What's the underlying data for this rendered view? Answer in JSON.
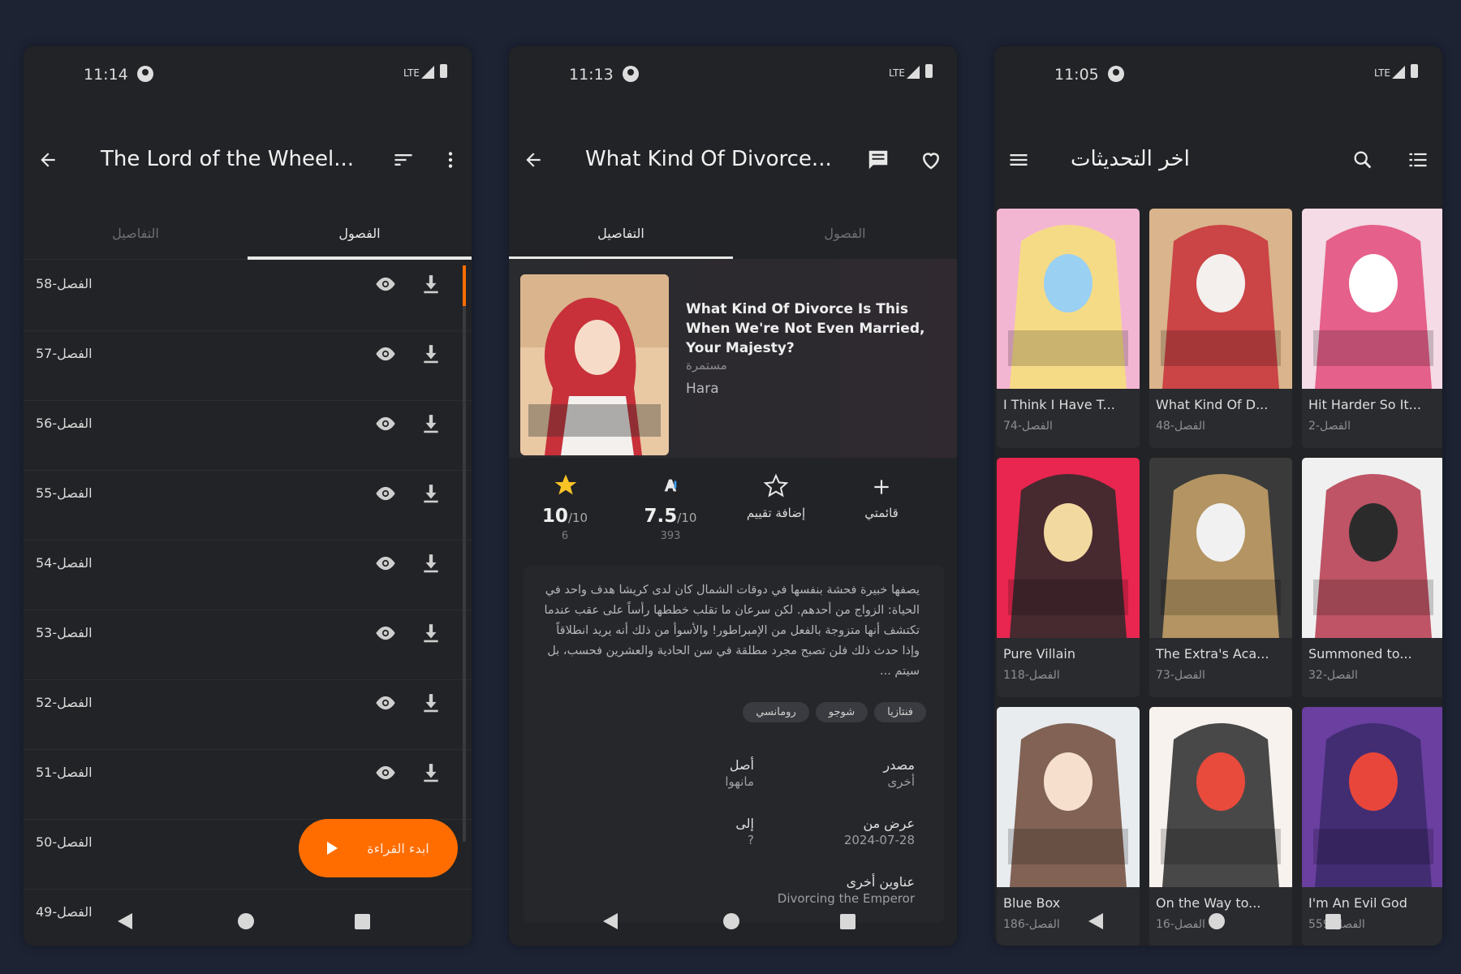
{
  "accent": "#ff6d00",
  "phone1": {
    "status": {
      "time": "11:14",
      "network": "LTE"
    },
    "title": "The Lord of the Wheel...",
    "tabs": [
      "التفاصيل",
      "الفصول"
    ],
    "chapters": [
      "الفصل-58",
      "الفصل-57",
      "الفصل-56",
      "الفصل-55",
      "الفصل-54",
      "الفصل-53",
      "الفصل-52",
      "الفصل-51",
      "الفصل-50",
      "الفصل-49"
    ],
    "fab_label": "ابدء القراءة",
    "icons": {
      "back": "arrow-back-icon",
      "sort": "sort-icon",
      "menu": "more-vert-icon",
      "eye": "eye-icon",
      "download": "download-icon",
      "play": "play-icon"
    }
  },
  "phone2": {
    "status": {
      "time": "11:13",
      "network": "LTE"
    },
    "title": "What Kind Of Divorce...",
    "tabs": [
      "التفاصيل",
      "الفصول"
    ],
    "manga_title": "What Kind Of Divorce Is This When We're Not Even Married, Your Majesty?",
    "status_text": "مستمرة",
    "author": "Hara",
    "stats": {
      "rating": {
        "value": "10",
        "suffix": "/10",
        "count": "6"
      },
      "anilist": {
        "value": "7.5",
        "suffix": "/10",
        "count": "393"
      },
      "rate": {
        "label": "إضافة تقييم"
      },
      "list": {
        "label": "قائمتي"
      }
    },
    "description": "يصفها خبيرة فحشة بنفسها في دوقات الشمال كان لدى كريشا هدف واحد في الحياة: الزواج من أحدهم. لكن سرعان ما تقلب خططها رأساً على عقب عندما تكتشف أنها متزوجة بالفعل من الإمبراطور! والأسوأ من ذلك أنه يريد انطلاقاً وإذا حدث ذلك فلن تصبح مجرد مطلقة في سن الحادية والعشرين فحسب، بل سيتم ...",
    "genres": [
      "فنتازيا",
      "شوجو",
      "رومانسي"
    ],
    "info": {
      "source_k": "مصدر",
      "source_v": "أخرى",
      "origin_k": "أصل",
      "origin_v": "مانهوا",
      "from_k": "عرض من",
      "from_v": "2024-07-28",
      "to_k": "إلى",
      "to_v": "?",
      "alt_k": "عناوين أخرى",
      "alt_v": "Divorcing the Emperor"
    },
    "icons": {
      "back": "arrow-back-icon",
      "comment": "comment-icon",
      "favorite": "heart-icon",
      "star": "star-filled-icon",
      "anilist": "anilist-icon",
      "rate": "star-outline-icon",
      "add": "plus-icon"
    }
  },
  "phone3": {
    "status": {
      "time": "11:05",
      "network": "LTE"
    },
    "title": "اخر التحديثات",
    "cards": [
      {
        "title": "I Think I Have T...",
        "chapter": "الفصل-74"
      },
      {
        "title": "What Kind Of D...",
        "chapter": "الفصل-48"
      },
      {
        "title": "Hit Harder So It...",
        "chapter": "الفصل-2"
      },
      {
        "title": "Pure Villain",
        "chapter": "الفصل-118"
      },
      {
        "title": "The Extra's Aca...",
        "chapter": "الفصل-73"
      },
      {
        "title": "Summoned to...",
        "chapter": "الفصل-32"
      },
      {
        "title": "Blue Box",
        "chapter": "الفصل-186"
      },
      {
        "title": "On the Way to...",
        "chapter": "الفصل-16"
      },
      {
        "title": "I'm An Evil God",
        "chapter": "الفصل-559"
      }
    ],
    "icons": {
      "menu": "hamburger-menu-icon",
      "search": "search-icon",
      "list": "list-view-icon"
    }
  },
  "nav_icons": [
    "back-triangle-icon",
    "home-circle-icon",
    "recents-square-icon"
  ]
}
